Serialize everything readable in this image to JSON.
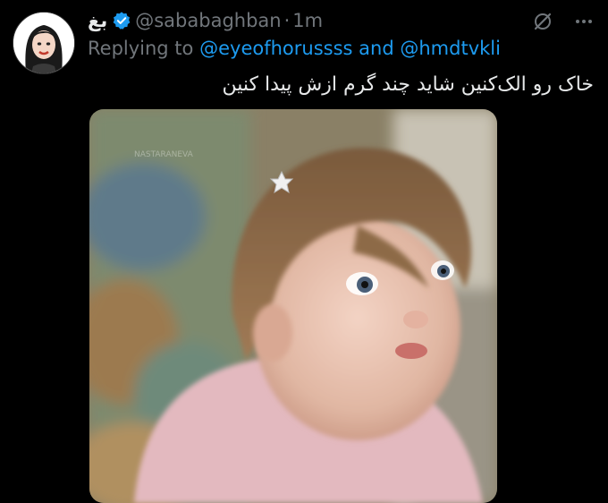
{
  "tweet": {
    "display_name": "بغ",
    "handle": "@sababaghban",
    "separator": "·",
    "time": "1m",
    "reply_prefix": "Replying to",
    "reply_mention_1": "@eyeofhorussss",
    "reply_and": "and",
    "reply_mention_2": "@hmdtvkli",
    "text": "خاک رو الک‌کنین شاید چند گرم ازش پیدا کنین",
    "media_watermark": "NASTARANEVA"
  },
  "icons": {
    "verified": "verified-badge-icon",
    "grok": "grok-icon",
    "more": "more-options-icon"
  },
  "colors": {
    "background": "#000000",
    "text": "#e7e9ea",
    "muted": "#71767b",
    "link": "#1d9bf0"
  }
}
